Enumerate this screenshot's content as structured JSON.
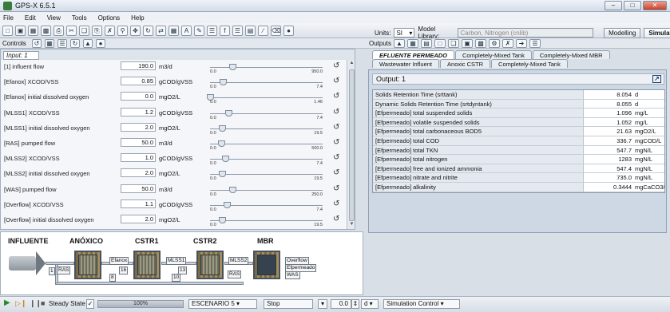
{
  "window": {
    "title": "GPS-X 6.5.1"
  },
  "menu": [
    "File",
    "Edit",
    "View",
    "Tools",
    "Options",
    "Help"
  ],
  "toolbar": {
    "units_label": "Units:",
    "units_value": "SI",
    "model_library_label": "Model Library:",
    "model_library_value": "Carbon, Nitrogen (cnlib)",
    "modelling_label": "Modelling",
    "simulation_label": "Simulation"
  },
  "controls": {
    "label": "Controls"
  },
  "input": {
    "tab_label": "Input: 1",
    "rows": [
      {
        "name": "[1] influent flow",
        "value": "190.0",
        "unit": "m3/d",
        "min": "0.0",
        "max": "950.0",
        "fraction": 0.2
      },
      {
        "name": "[Efanox] XCOD/VSS",
        "value": "0.85",
        "unit": "gCOD/gVSS",
        "min": "0.0",
        "max": "7.4",
        "fraction": 0.115
      },
      {
        "name": "[Efanox] initial dissolved oxygen",
        "value": "0.0",
        "unit": "mgO2/L",
        "min": "0.0",
        "max": "1.46",
        "fraction": 0.0
      },
      {
        "name": "[MLSS1] XCOD/VSS",
        "value": "1.2",
        "unit": "gCOD/gVSS",
        "min": "0.0",
        "max": "7.4",
        "fraction": 0.162
      },
      {
        "name": "[MLSS1] initial dissolved oxygen",
        "value": "2.0",
        "unit": "mgO2/L",
        "min": "0.0",
        "max": "19.5",
        "fraction": 0.103
      },
      {
        "name": "[RAS] pumped flow",
        "value": "50.0",
        "unit": "m3/d",
        "min": "0.0",
        "max": "500.0",
        "fraction": 0.1
      },
      {
        "name": "[MLSS2] XCOD/VSS",
        "value": "1.0",
        "unit": "gCOD/gVSS",
        "min": "0.0",
        "max": "7.4",
        "fraction": 0.135
      },
      {
        "name": "[MLSS2] initial dissolved oxygen",
        "value": "2.0",
        "unit": "mgO2/L",
        "min": "0.0",
        "max": "19.5",
        "fraction": 0.103
      },
      {
        "name": "[WAS] pumped flow",
        "value": "50.0",
        "unit": "m3/d",
        "min": "0.0",
        "max": "250.0",
        "fraction": 0.2
      },
      {
        "name": "[Overflow] XCOD/VSS",
        "value": "1.1",
        "unit": "gCOD/gVSS",
        "min": "0.0",
        "max": "7.4",
        "fraction": 0.149
      },
      {
        "name": "[Overflow] initial dissolved oxygen",
        "value": "2.0",
        "unit": "mgO2/L",
        "min": "0.0",
        "max": "19.5",
        "fraction": 0.103
      }
    ]
  },
  "diagram": {
    "labels": [
      "INFLUENTE",
      "ANÓXICO",
      "CSTR1",
      "CSTR2",
      "MBR"
    ],
    "tags": [
      "1",
      "Efanox",
      "MLSS1",
      "MLSS2",
      "Overflow",
      "Efpermeado",
      "WAS",
      "RAS",
      "RAS",
      "16",
      "13",
      "10",
      "8"
    ]
  },
  "outputs": {
    "label": "Outputs",
    "tabs_row1": [
      "EFLUENTE PERMEADO",
      "Completely-Mixed Tank",
      "Completely-Mixed MBR"
    ],
    "tabs_row2": [
      "Wastewater Influent",
      "Anoxic CSTR",
      "Completely-Mixed Tank"
    ],
    "panel_title": "Output: 1",
    "rows": [
      {
        "name": "Solids Retention Time (srttank)",
        "value": "8.054",
        "unit": "d"
      },
      {
        "name": "Dynamic Solids Retention Time (srtdyntank)",
        "value": "8.055",
        "unit": "d"
      },
      {
        "name": "[Efpermeado] total suspended solids",
        "value": "1.096",
        "unit": "mg/L"
      },
      {
        "name": "[Efpermeado] volatile suspended solids",
        "value": "1.052",
        "unit": "mg/L"
      },
      {
        "name": "[Efpermeado] total carbonaceous BOD5",
        "value": "21.63",
        "unit": "mgO2/L"
      },
      {
        "name": "[Efpermeado] total COD",
        "value": "336.7",
        "unit": "mgCOD/L"
      },
      {
        "name": "[Efpermeado] total TKN",
        "value": "547.7",
        "unit": "mgN/L"
      },
      {
        "name": "[Efpermeado] total nitrogen",
        "value": "1283",
        "unit": "mgN/L"
      },
      {
        "name": "[Efpermeado] free and ionized ammonia",
        "value": "547.4",
        "unit": "mgN/L"
      },
      {
        "name": "[Efpermeado] nitrate and nitrite",
        "value": "735.0",
        "unit": "mgN/L"
      },
      {
        "name": "[Efpermeado] alkalinity",
        "value": "0.3444",
        "unit": "mgCaCO3/L"
      }
    ]
  },
  "statusbar": {
    "steady_state": "Steady State",
    "progress_text": "100%",
    "progress": 1.0,
    "scenario": "ESCENARIO 5",
    "stop": "Stop",
    "time_value": "0.0",
    "time_unit": "d",
    "sim_control": "Simulation Control"
  }
}
